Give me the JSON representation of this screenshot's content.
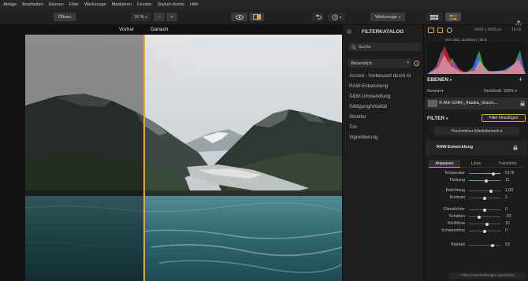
{
  "menu": [
    "Ablage",
    "Bearbeiten",
    "Ebenen",
    "Filter",
    "Werkzeuge",
    "Maskieren",
    "Fenster",
    "Skylum-Konto",
    "Hilfe"
  ],
  "toolbar": {
    "open_label": "Öffnen",
    "zoom_value": "16 %",
    "zoom_out": "−",
    "zoom_in": "+",
    "tools_label": "Werkzeuge"
  },
  "compare": {
    "before": "Vorher",
    "after": "Danach"
  },
  "catalog": {
    "title": "FILTERKATALOG",
    "search_placeholder": "Suche",
    "dropdown": "Wesentlich",
    "items": [
      "Accent - Verbessert durch AI",
      "RAW-Entwicklung",
      "S&W-Umwandlung",
      "Sättigung/Vitalität",
      "Struktur",
      "Ton",
      "Vignettierung"
    ]
  },
  "info": {
    "dimensions": "6000 x 4000 px",
    "bitdepth": "16-bit",
    "exif": "ISO 400  |  16,00mm  |  f/5.6"
  },
  "layers": {
    "title": "EBENEN",
    "mode": "Normal",
    "opacity": "Deckkraft: 100%",
    "layer_name": "© Alik Griffin_Alaska_Glacie..."
  },
  "filter": {
    "title": "FILTER",
    "add_button": "Filter hinzufügen",
    "workspace": "Persönlicher Arbeitsbereich",
    "raw_title": "RAW-Entwicklung",
    "tabs": [
      "Anpassen",
      "Linse",
      "Transform"
    ],
    "sliders": [
      {
        "label": "Temperatur",
        "value": "5176",
        "pos": 0.78
      },
      {
        "label": "Färbung",
        "value": "11",
        "pos": 0.56
      },
      {
        "label": "Belichtung",
        "value": "1,00",
        "pos": 0.7
      },
      {
        "label": "Kontrast",
        "value": "2",
        "pos": 0.51
      },
      {
        "label": "Glanzlichter",
        "value": "0",
        "pos": 0.5
      },
      {
        "label": "Schatten",
        "value": "-33",
        "pos": 0.33
      },
      {
        "label": "Weißtöne",
        "value": "15",
        "pos": 0.57
      },
      {
        "label": "Schwarztöne",
        "value": "0",
        "pos": 0.5
      },
      {
        "label": "Klarheit",
        "value": "53",
        "pos": 0.76
      }
    ],
    "save_button": "Filtervoreinstellungen speichern"
  },
  "colors": {
    "accent": "#e8a33a",
    "panel": "#1c1c1c"
  }
}
